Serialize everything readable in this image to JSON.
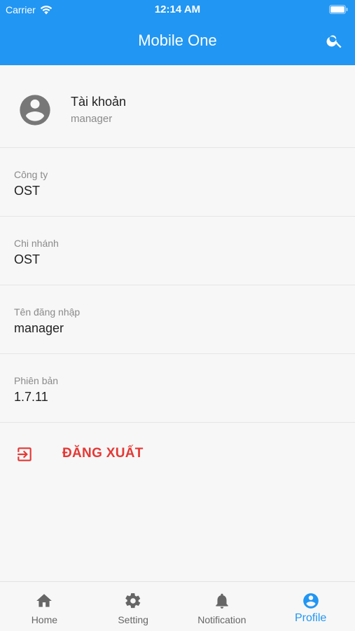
{
  "status_bar": {
    "carrier": "Carrier",
    "time": "12:14 AM"
  },
  "header": {
    "title": "Mobile One",
    "search_icon": "search-icon"
  },
  "account": {
    "title": "Tài khoản",
    "username": "manager",
    "avatar_icon": "account-circle-icon"
  },
  "info": [
    {
      "label": "Công ty",
      "value": "OST"
    },
    {
      "label": "Chi nhánh",
      "value": "OST"
    },
    {
      "label": "Tên đăng nhập",
      "value": "manager"
    },
    {
      "label": "Phiên bản",
      "value": "1.7.11"
    }
  ],
  "logout": {
    "label": "ĐĂNG XUẤT",
    "icon": "logout-icon"
  },
  "tabs": [
    {
      "label": "Home",
      "icon": "home-icon",
      "active": false
    },
    {
      "label": "Setting",
      "icon": "gear-icon",
      "active": false
    },
    {
      "label": "Notification",
      "icon": "bell-icon",
      "active": false
    },
    {
      "label": "Profile",
      "icon": "account-circle-icon",
      "active": true
    }
  ],
  "colors": {
    "primary": "#2196f3",
    "danger": "#e53935",
    "inactive": "#666666"
  }
}
